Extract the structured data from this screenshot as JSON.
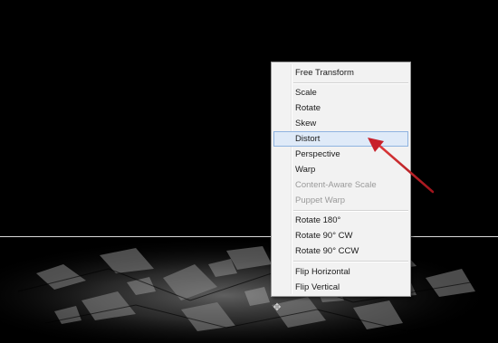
{
  "context_menu": {
    "items": [
      {
        "label": "Free Transform",
        "enabled": true
      },
      {
        "label": "Scale",
        "enabled": true
      },
      {
        "label": "Rotate",
        "enabled": true
      },
      {
        "label": "Skew",
        "enabled": true
      },
      {
        "label": "Distort",
        "enabled": true,
        "highlighted": true
      },
      {
        "label": "Perspective",
        "enabled": true
      },
      {
        "label": "Warp",
        "enabled": true
      },
      {
        "label": "Content-Aware Scale",
        "enabled": false
      },
      {
        "label": "Puppet Warp",
        "enabled": false
      },
      {
        "label": "Rotate 180°",
        "enabled": true
      },
      {
        "label": "Rotate 90° CW",
        "enabled": true
      },
      {
        "label": "Rotate 90° CCW",
        "enabled": true
      },
      {
        "label": "Flip Horizontal",
        "enabled": true
      },
      {
        "label": "Flip Vertical",
        "enabled": true
      }
    ]
  },
  "colors": {
    "background": "#000000",
    "menu_background": "#f2f2f2",
    "highlight_fill": "#dfeaf8",
    "highlight_border": "#8fb3e0",
    "annotation_arrow": "#c8202a",
    "disabled_text": "#9a9a9a"
  },
  "icons": {
    "cursor": "transform-move-cursor-icon",
    "arrow": "red-annotation-arrow-icon"
  }
}
